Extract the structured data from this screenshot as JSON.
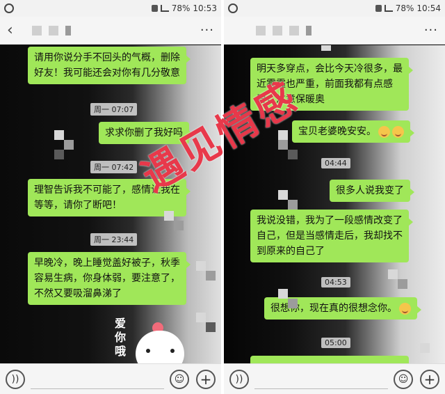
{
  "left": {
    "status": {
      "battery": "78%",
      "time": "10:53"
    },
    "bubbles": [
      "请用你说分手不回头的气概，删除好友！我可能还会对你有几分敬意",
      "求求你删了我好吗",
      "理智告诉我不可能了，感情让我在等等，请你了断吧！",
      "早晚冷，晚上睡觉盖好被子，秋季容易生病，你身体弱，要注意了，不然又要吸溜鼻涕了"
    ],
    "times": [
      "周一 07:07",
      "周一 07:42",
      "周一 23:44"
    ],
    "sticker_text": "爱你哦"
  },
  "right": {
    "status": {
      "battery": "78%",
      "time": "10:54"
    },
    "bubbles": [
      "明天多穿点，会比今天冷很多，最近雾霾也严重，前面我都有点感冒，注意保暖奥",
      "宝贝老婆晚安安。",
      "很多人说我变了",
      "我说没错，我为了一段感情改变了自己，但是当感情走后，我却找不到原来的自己了",
      "很想你，现在真的很想念你。"
    ],
    "times": [
      "04:44",
      "04:53",
      "05:00"
    ]
  },
  "watermark": "遇见情感"
}
